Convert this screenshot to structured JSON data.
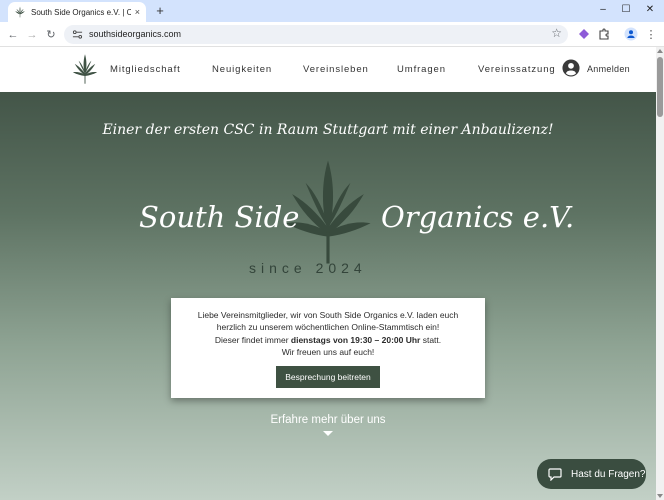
{
  "browser": {
    "tab_title": "South Side Organics e.V. | Cann",
    "tab_close": "×",
    "new_tab": "+",
    "window_controls": {
      "minimize": "–",
      "maximize": "☐",
      "close": "✕"
    },
    "nav": {
      "back": "←",
      "forward": "→",
      "reload": "↻"
    },
    "url": "southsideorganics.com",
    "bookmark_star": "☆",
    "menu": "⋮"
  },
  "site_header": {
    "menu": [
      {
        "label": "Mitgliedschaft"
      },
      {
        "label": "Neuigkeiten"
      },
      {
        "label": "Vereinsleben"
      },
      {
        "label": "Umfragen"
      },
      {
        "label": "Vereinssatzung"
      }
    ],
    "login_label": "Anmelden"
  },
  "hero": {
    "tagline": "Einer der ersten CSC in Raum Stuttgart mit einer Anbaulizenz!",
    "brand_left": "South Side",
    "brand_right": "Organics e.V.",
    "since": "since  2024",
    "card": {
      "line1": "Liebe Vereinsmitglieder, wir von South Side Organics e.V. laden euch",
      "line2": "herzlich zu unserem wöchentlichen Online-Stammtisch ein!",
      "line3_pre": "Dieser findet immer ",
      "line3_bold": "dienstags von 19:30 – 20:00 Uhr",
      "line3_post": " statt.",
      "line4": "Wir freuen uns auf euch!",
      "button_label": "Besprechung beitreten"
    },
    "learn_more": "Erfahre mehr über uns"
  },
  "chat": {
    "label": "Hast du Fragen?"
  },
  "colors": {
    "brand_dark": "#3a4d40",
    "hero_top": "#435548",
    "hero_bottom": "#c2d0c6",
    "chrome_tabstrip": "#d3e3fd"
  }
}
